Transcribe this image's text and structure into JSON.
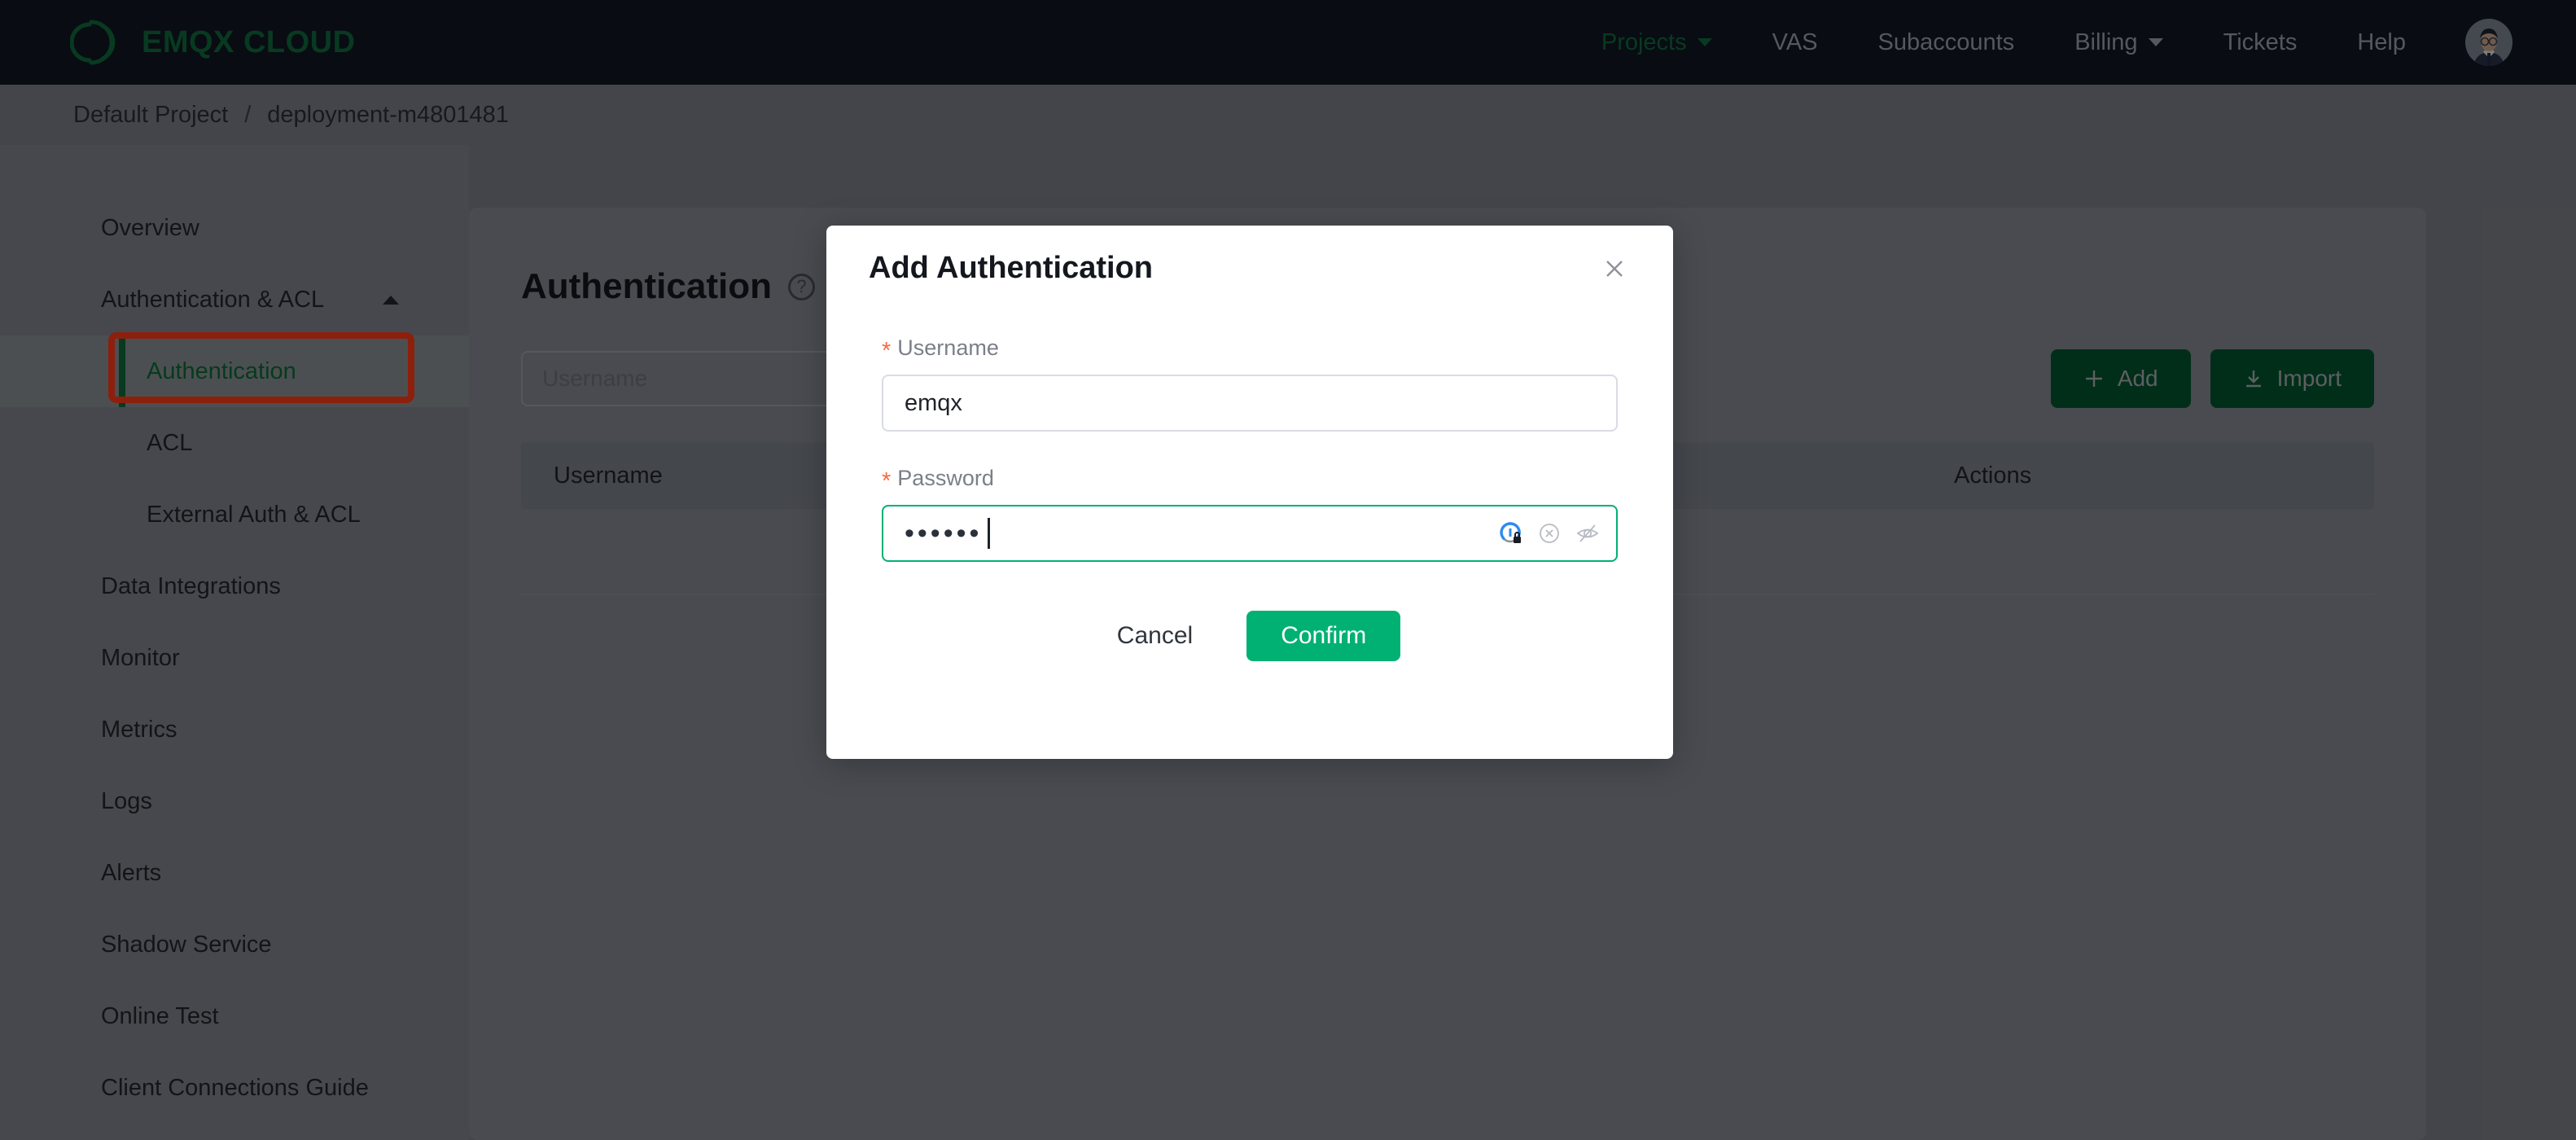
{
  "topnav": {
    "brand": "EMQX CLOUD",
    "brand_color": "#0f6b3c",
    "background": "#121722",
    "items": [
      {
        "label": "Projects",
        "has_caret": true,
        "active": true
      },
      {
        "label": "VAS",
        "has_caret": false,
        "active": false
      },
      {
        "label": "Subaccounts",
        "has_caret": false,
        "active": false
      },
      {
        "label": "Billing",
        "has_caret": true,
        "active": false
      },
      {
        "label": "Tickets",
        "has_caret": false,
        "active": false
      },
      {
        "label": "Help",
        "has_caret": false,
        "active": false
      }
    ],
    "avatar_alt": "user-avatar"
  },
  "breadcrumb": {
    "project": "Default Project",
    "separator": "/",
    "deployment": "deployment-m4801481"
  },
  "sidebar": {
    "items": [
      {
        "label": "Overview",
        "type": "item"
      },
      {
        "label": "Authentication & ACL",
        "type": "group",
        "expanded": true
      },
      {
        "label": "Authentication",
        "type": "sub",
        "selected": true
      },
      {
        "label": "ACL",
        "type": "sub",
        "selected": false
      },
      {
        "label": "External Auth & ACL",
        "type": "sub",
        "selected": false
      },
      {
        "label": "Data Integrations",
        "type": "item"
      },
      {
        "label": "Monitor",
        "type": "item"
      },
      {
        "label": "Metrics",
        "type": "item"
      },
      {
        "label": "Logs",
        "type": "item"
      },
      {
        "label": "Alerts",
        "type": "item"
      },
      {
        "label": "Shadow Service",
        "type": "item"
      },
      {
        "label": "Online Test",
        "type": "item"
      },
      {
        "label": "Client Connections Guide",
        "type": "item"
      }
    ],
    "highlight_color": "#ff3b16",
    "selected_accent": "#0d6b38"
  },
  "main": {
    "page_title": "Authentication",
    "help_icon": "question-mark-icon",
    "search_placeholder": "Username",
    "add_label": "Add",
    "add_icon": "plus-icon",
    "import_label": "Import",
    "import_icon": "download-icon",
    "table_headers": [
      "Username",
      "Actions"
    ]
  },
  "modal": {
    "title": "Add Authentication",
    "close_icon": "close-icon",
    "username": {
      "label": "Username",
      "required_marker": "*",
      "value": "emqx"
    },
    "password": {
      "label": "Password",
      "required_marker": "*",
      "value": "••••••",
      "masked_char_count": 6,
      "focused": true,
      "icons": [
        "password-manager-icon",
        "clear-input-icon",
        "toggle-password-visibility-icon"
      ]
    },
    "cancel_label": "Cancel",
    "confirm_label": "Confirm",
    "confirm_color": "#00b173"
  }
}
